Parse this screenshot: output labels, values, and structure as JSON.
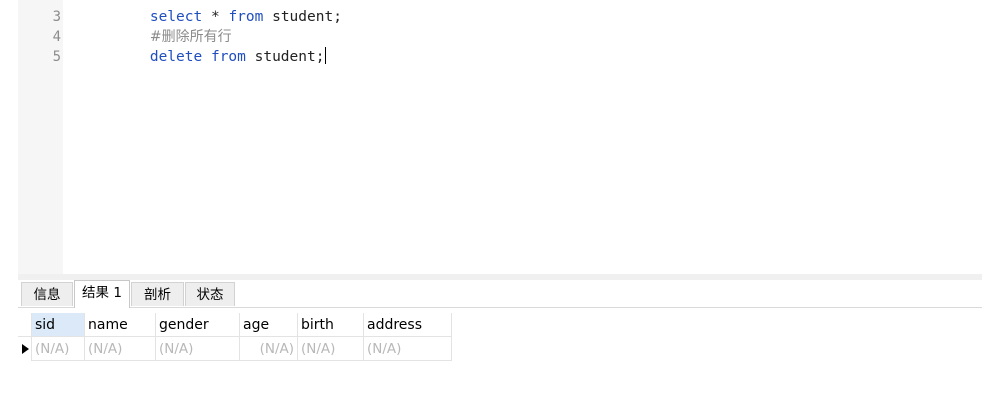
{
  "editor": {
    "lines": [
      {
        "number": "3",
        "keyword1": "select",
        "middle": " * ",
        "keyword2": "from",
        "rest": " student;"
      },
      {
        "number": "4",
        "comment": "#删除所有行"
      },
      {
        "number": "5",
        "keyword1": "delete",
        "middle": " ",
        "keyword2": "from",
        "rest": " student;"
      }
    ]
  },
  "tabs": [
    {
      "label": "信息"
    },
    {
      "label": "结果 1"
    },
    {
      "label": "剖析"
    },
    {
      "label": "状态"
    }
  ],
  "active_tab_index": 1,
  "results": {
    "columns": [
      "sid",
      "name",
      "gender",
      "age",
      "birth",
      "address"
    ],
    "rows": [
      [
        "(N/A)",
        "(N/A)",
        "(N/A)",
        "(N/A)",
        "(N/A)",
        "(N/A)"
      ]
    ]
  },
  "icons": {
    "row_indicator": "current-row-arrow-icon"
  },
  "colors": {
    "keyword": "#1f4fbf",
    "comment": "#8c8c8c",
    "null_value": "#b8b8b8",
    "selected_header": "#dbe9f8"
  }
}
